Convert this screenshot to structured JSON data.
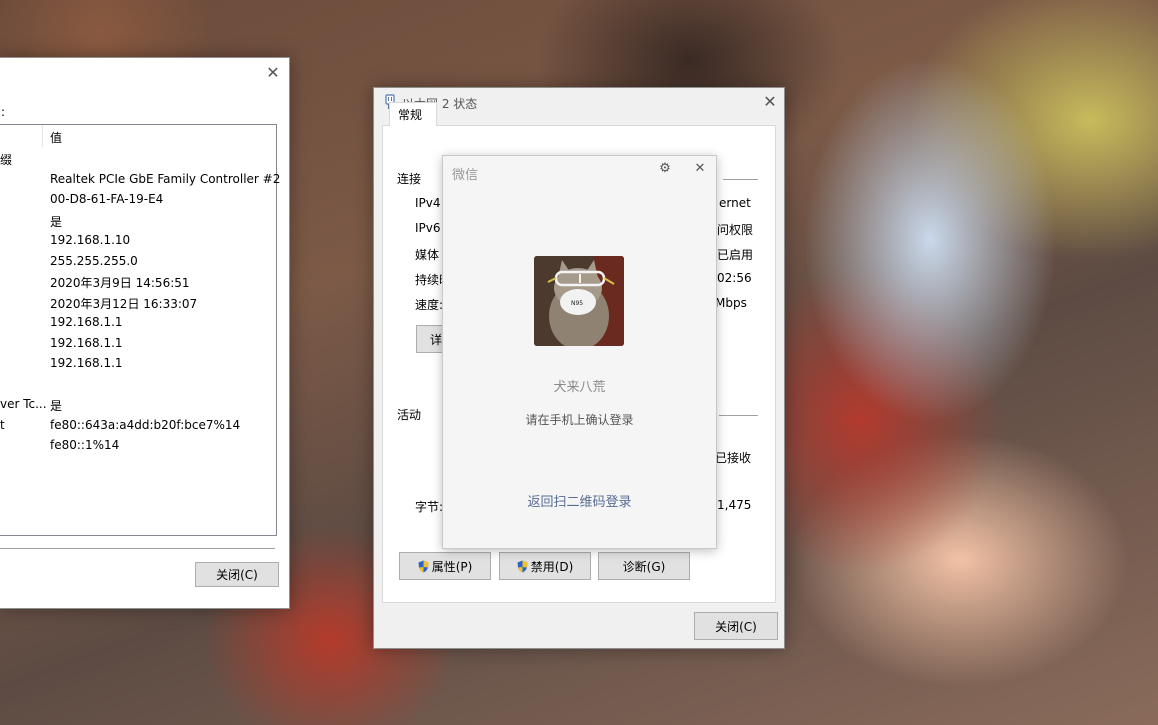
{
  "details_window": {
    "header_label": ":",
    "column_value_header": "值",
    "rows": [
      {
        "key": "缀",
        "value": ""
      },
      {
        "key": "",
        "value": "Realtek PCIe GbE Family Controller #2"
      },
      {
        "key": "",
        "value": "00-D8-61-FA-19-E4"
      },
      {
        "key": "",
        "value": "是"
      },
      {
        "key": "",
        "value": "192.168.1.10"
      },
      {
        "key": "",
        "value": "255.255.255.0"
      },
      {
        "key": "",
        "value": "2020年3月9日 14:56:51"
      },
      {
        "key": "",
        "value": "2020年3月12日 16:33:07"
      },
      {
        "key": "",
        "value": "192.168.1.1"
      },
      {
        "key": "",
        "value": "192.168.1.1"
      },
      {
        "key": "",
        "value": "192.168.1.1"
      },
      {
        "key": "",
        "value": ""
      },
      {
        "key": "ver Tc...",
        "value": "是"
      },
      {
        "key": "t",
        "value": "fe80::643a:a4dd:b20f:bce7%14"
      },
      {
        "key": "",
        "value": "fe80::1%14"
      }
    ],
    "close_button": "关闭(C)"
  },
  "status_window": {
    "title": "以太网 2 状态",
    "tab_general": "常规",
    "section_connection": "连接",
    "ipv4_label": "IPv4",
    "ipv4_value": "ernet",
    "ipv6_label": "IPv6",
    "ipv6_value": "问权限",
    "media_label": "媒体",
    "media_value": "已启用",
    "duration_label": "持续时",
    "duration_value": "02:56",
    "speed_label": "速度:",
    "speed_value": "Mbps",
    "details_button_partial": "详",
    "section_activity": "活动",
    "received_label": "已接收",
    "bytes_label": "字节:",
    "bytes_received": "1,475",
    "properties_button": "属性(P)",
    "disable_button": "禁用(D)",
    "diagnose_button": "诊断(G)",
    "close_button": "关闭(C)"
  },
  "wechat_dialog": {
    "title": "微信",
    "user_name": "犬来八荒",
    "prompt": "请在手机上确认登录",
    "back_to_qr_link": "返回扫二维码登录",
    "avatar_mask_text": "N95"
  },
  "colors": {
    "link": "#576b95",
    "shield_blue": "#2b64c8",
    "shield_yellow": "#f2c12e"
  }
}
